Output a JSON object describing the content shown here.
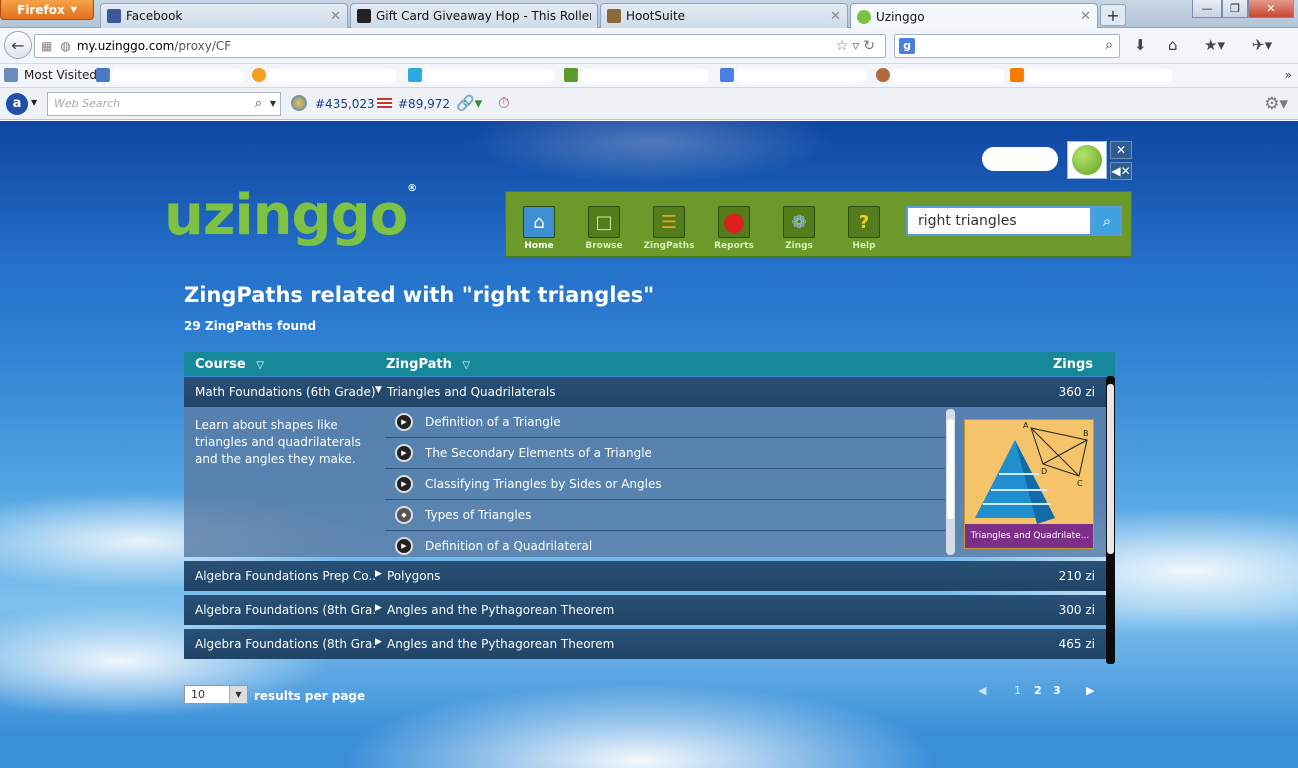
{
  "browser": {
    "menu_button": "Firefox",
    "tabs": [
      {
        "title": "Facebook",
        "icon": "facebook-icon",
        "color": "#3b5998"
      },
      {
        "title": "Gift Card Giveaway Hop - This Roller ...",
        "icon": "page-icon",
        "color": "#222222"
      },
      {
        "title": "HootSuite",
        "icon": "hootsuite-icon",
        "color": "#8a6a3a"
      },
      {
        "title": "Uzinggo",
        "icon": "uzinggo-icon",
        "color": "#7dc242"
      }
    ],
    "new_tab": "+",
    "window": {
      "minimize": "—",
      "restore": "❐",
      "close": "✕"
    },
    "url": {
      "host": "my.uzinggo.com",
      "path": "/proxy/CF"
    },
    "search_engine": "g"
  },
  "bookmarks": {
    "most_visited": "Most Visited",
    "more": "»"
  },
  "toolbar": {
    "web_search_placeholder": "Web Search",
    "rank_global": "#435,023",
    "rank_us": "#89,972"
  },
  "site": {
    "logo": "uzinggo",
    "registered": "®",
    "nav": [
      {
        "label": "Home",
        "icon": "home-icon",
        "glyph": "⌂"
      },
      {
        "label": "Browse",
        "icon": "folder-icon",
        "glyph": "□"
      },
      {
        "label": "ZingPaths",
        "icon": "zingpaths-icon",
        "glyph": "☰"
      },
      {
        "label": "Reports",
        "icon": "reports-icon",
        "glyph": "●"
      },
      {
        "label": "Zings",
        "icon": "ribbon-icon",
        "glyph": "❁"
      },
      {
        "label": "Help",
        "icon": "help-icon",
        "glyph": "?"
      }
    ],
    "search_value": "right triangles",
    "close_btn": "✕",
    "mute_btn": "◀✕"
  },
  "results": {
    "title": "ZingPaths related with \"right triangles\"",
    "count": "29 ZingPaths found",
    "columns": {
      "course": "Course",
      "zingpath": "ZingPath",
      "zings": "Zings"
    },
    "rows": [
      {
        "course": "Math Foundations (6th Grade)",
        "path": "Triangles and Quadrilaterals",
        "zings": "360 zi",
        "expanded": true
      },
      {
        "course": "Algebra Foundations Prep Co...",
        "path": "Polygons",
        "zings": "210 zi",
        "expanded": false
      },
      {
        "course": "Algebra Foundations (8th Gra...",
        "path": "Angles and the Pythagorean Theorem",
        "zings": "300 zi",
        "expanded": false
      },
      {
        "course": "Algebra Foundations (8th Gra...",
        "path": "Angles and the Pythagorean Theorem",
        "zings": "465 zi",
        "expanded": false
      }
    ],
    "expanded_description": "Learn about shapes like triangles and quadrilaterals and the angles they make.",
    "lessons": [
      "Definition of a Triangle",
      "The Secondary Elements of a Triangle",
      "Classifying Triangles by Sides or Angles",
      "Types of Triangles",
      "Definition of a Quadrilateral"
    ],
    "thumbnail_caption": "Triangles and Quadrilate...",
    "thumbnail_labels": [
      "A",
      "B",
      "C",
      "D"
    ]
  },
  "footer": {
    "per_page_value": "10",
    "per_page_label": "results per page",
    "pages": [
      "1",
      "2",
      "3"
    ],
    "prev": "◀",
    "next": "▶"
  }
}
